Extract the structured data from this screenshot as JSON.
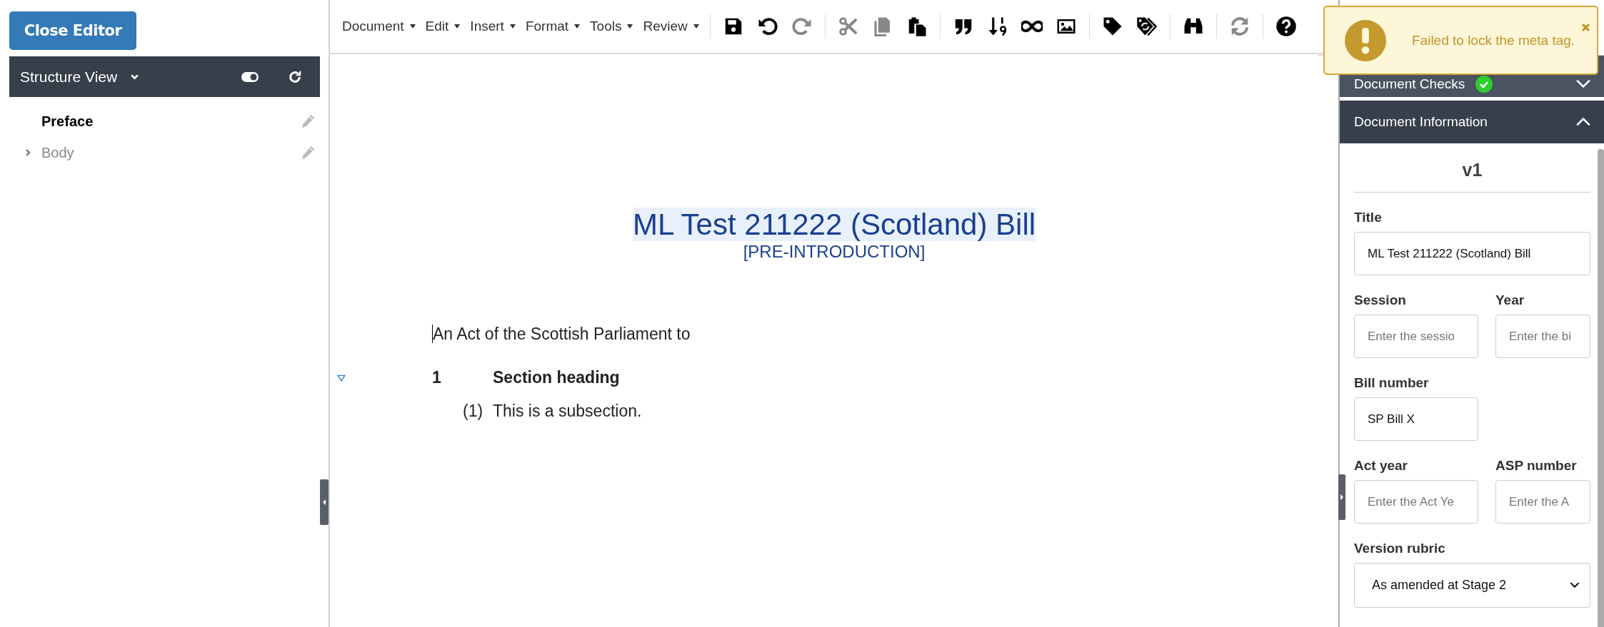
{
  "left_panel": {
    "close_button": "Close Editor",
    "structure_view": {
      "title": "Structure View",
      "toggle_on": true
    },
    "tree": [
      {
        "label": "Preface",
        "kind": "leaf",
        "selected": true
      },
      {
        "label": "Body",
        "kind": "branch",
        "selected": false
      }
    ]
  },
  "toolbar": {
    "menus": [
      {
        "label": "Document"
      },
      {
        "label": "Edit"
      },
      {
        "label": "Insert"
      },
      {
        "label": "Format"
      },
      {
        "label": "Tools"
      },
      {
        "label": "Review"
      }
    ],
    "tool_groups": [
      [
        {
          "kind": "save",
          "disabled": false
        },
        {
          "kind": "undo",
          "disabled": false
        },
        {
          "kind": "redo",
          "disabled": true
        }
      ],
      [
        {
          "kind": "cut",
          "disabled": true
        },
        {
          "kind": "copy",
          "disabled": true
        },
        {
          "kind": "paste",
          "disabled": false
        }
      ],
      [
        {
          "kind": "quote",
          "disabled": false
        },
        {
          "kind": "sort",
          "disabled": false
        },
        {
          "kind": "link",
          "disabled": false
        },
        {
          "kind": "image",
          "disabled": false
        }
      ],
      [
        {
          "kind": "tag",
          "disabled": false
        },
        {
          "kind": "tag-sync",
          "disabled": false
        }
      ],
      [
        {
          "kind": "binoculars",
          "disabled": false
        }
      ],
      [
        {
          "kind": "sync",
          "disabled": true
        }
      ],
      [
        {
          "kind": "help",
          "disabled": false
        }
      ]
    ]
  },
  "document": {
    "title": "ML Test 211222 (Scotland) Bill",
    "status": "[PRE-INTRODUCTION]",
    "long_title": "An Act of the Scottish Parliament to",
    "section": {
      "number": "1",
      "heading": "Section heading",
      "subsections": [
        {
          "number": "(1)",
          "text": "This is a subsection."
        }
      ]
    }
  },
  "right_panel": {
    "sections": [
      {
        "title": "Document Checks",
        "expanded": false,
        "passed": true
      },
      {
        "title": "Document Information",
        "expanded": true
      }
    ],
    "version": "v1",
    "field_rows": [
      [
        {
          "label": "Title",
          "kind": "text",
          "value": "ML Test 211222 (Scotland) Bill"
        }
      ],
      [
        {
          "label": "Session",
          "kind": "text",
          "placeholder": "Enter the sessio"
        },
        {
          "label": "Year",
          "kind": "text",
          "placeholder": "Enter the bi"
        }
      ],
      [
        {
          "label": "Bill number",
          "kind": "text",
          "value": "SP Bill X"
        }
      ],
      [
        {
          "label": "Act year",
          "kind": "text",
          "placeholder": "Enter the Act Ye"
        },
        {
          "label": "ASP number",
          "kind": "text",
          "placeholder": "Enter the A"
        }
      ],
      [
        {
          "label": "Version rubric",
          "kind": "select",
          "value": "As amended at Stage 2"
        }
      ]
    ]
  },
  "toast": {
    "kind": "warning",
    "message": "Failed to lock the meta tag."
  }
}
